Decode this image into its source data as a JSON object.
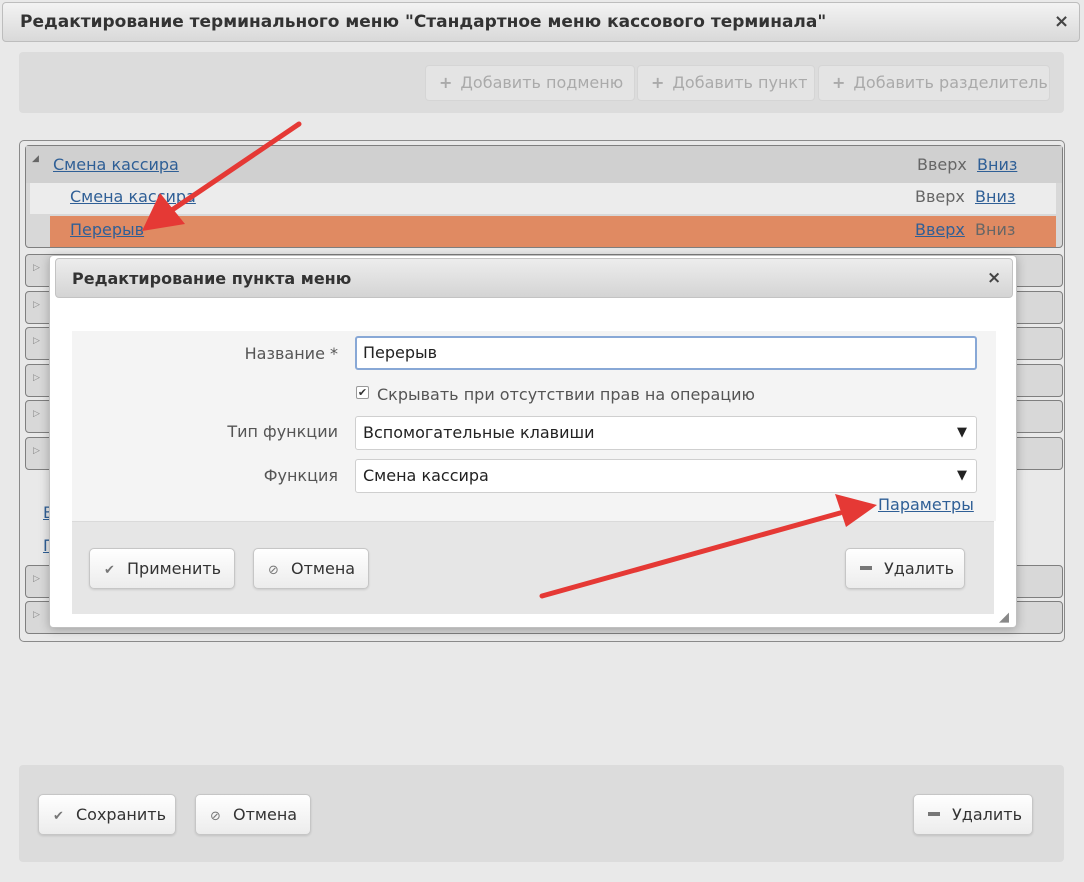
{
  "window": {
    "title": "Редактирование терминального меню \"Стандартное меню кассового терминала\"",
    "close_icon": "×"
  },
  "toolbar": {
    "add_submenu": "Добавить подменю",
    "add_item": "Добавить пункт",
    "add_separator": "Добавить разделитель",
    "plus_icon": "+"
  },
  "tree": {
    "root": {
      "label": "Смена кассира",
      "up": "Вверх",
      "down": "Вниз"
    },
    "children": [
      {
        "label": "Смена кассира",
        "up": "Вверх",
        "down": "Вниз"
      },
      {
        "label": "Перерыв",
        "up": "Вверх",
        "down": "Вниз"
      }
    ],
    "side_links": [
      "В",
      "П"
    ],
    "triangle_expanded": "◢",
    "triangle_collapsed": "▷"
  },
  "dialog": {
    "title": "Редактирование пункта меню",
    "close_icon": "×",
    "name_label": "Название *",
    "name_value": "Перерыв",
    "hide_checkbox_label": "Скрывать при отсутствии прав на операцию",
    "hide_checkbox_checked": true,
    "checkmark": "✔",
    "func_type_label": "Тип функции",
    "func_type_value": "Вспомогательные клавиши",
    "function_label": "Функция",
    "function_value": "Смена кассира",
    "dropdown_arrow": "▼",
    "params_link": "Параметры",
    "apply_button": "Применить",
    "cancel_button": "Отмена",
    "delete_button": "Удалить",
    "check_icon": "✔",
    "cancel_icon": "⊘",
    "resize_icon": "◢"
  },
  "footer": {
    "save_button": "Сохранить",
    "cancel_button": "Отмена",
    "delete_button": "Удалить"
  },
  "colors": {
    "selected_row": "#e08a62",
    "link": "#2f5f96",
    "annotation_arrow": "#e53935"
  }
}
